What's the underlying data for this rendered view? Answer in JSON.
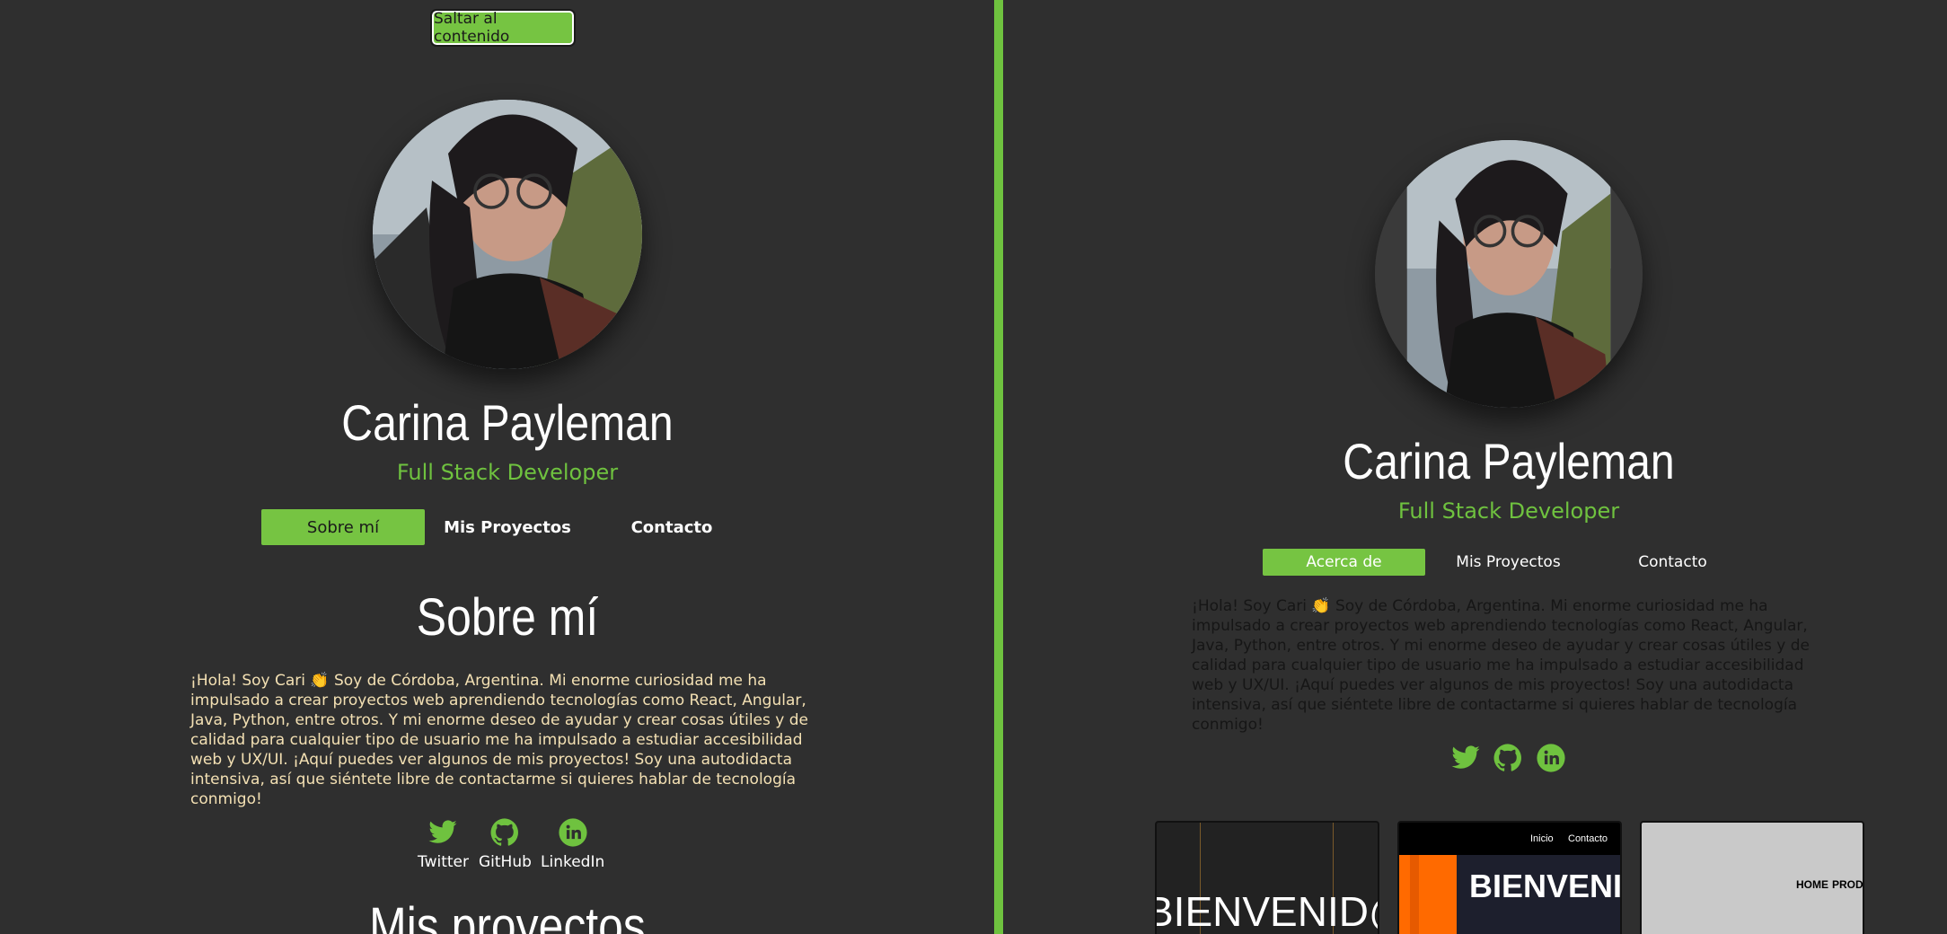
{
  "accent": "#6fc23f",
  "left": {
    "skip_link": "Saltar al contenido",
    "name": "Carina Payleman",
    "role": "Full Stack Developer",
    "nav": [
      "Sobre mí",
      "Mis Proyectos",
      "Contacto"
    ],
    "section_title": "Sobre mí",
    "bio": "¡Hola! Soy Cari 👏 Soy de Córdoba, Argentina. Mi enorme curiosidad me ha impulsado a crear proyectos web aprendiendo tecnologías como React, Angular, Java, Python, entre otros. Y mi enorme deseo de ayudar y crear cosas útiles y de calidad para cualquier tipo de usuario me ha impulsado a estudiar accesibilidad web y UX/UI. ¡Aquí puedes ver algunos de mis proyectos! Soy una autodidacta intensiva, así que siéntete libre de contactarme si quieres hablar de tecnología conmigo!",
    "social": [
      {
        "icon": "twitter-icon",
        "label": "Twitter"
      },
      {
        "icon": "github-icon",
        "label": "GitHub"
      },
      {
        "icon": "linkedin-icon",
        "label": "LinkedIn"
      }
    ],
    "next_section_title": "Mis proyectos"
  },
  "right": {
    "name": "Carina Payleman",
    "role": "Full Stack Developer",
    "nav": [
      "Acerca de",
      "Mis Proyectos",
      "Contacto"
    ],
    "bio": "¡Hola! Soy Cari 👏 Soy de Córdoba, Argentina. Mi enorme curiosidad me ha impulsado a crear proyectos web aprendiendo tecnologías como React, Angular, Java, Python, entre otros. Y mi enorme deseo de ayudar y crear cosas útiles y de calidad para cualquier tipo de usuario me ha impulsado a estudiar accesibilidad web y UX/UI. ¡Aquí puedes ver algunos de mis proyectos! Soy una autodidacta intensiva, así que siéntete libre de contactarme si quieres hablar de tecnología conmigo!",
    "social_icons": [
      "twitter-icon",
      "github-icon",
      "linkedin-icon"
    ],
    "projects": [
      {
        "headline": "BIENVENID@"
      },
      {
        "headline": "BIENVENID",
        "nav": [
          "Inicio",
          "Contacto"
        ]
      },
      {
        "nav": [
          "HOME",
          "PROD"
        ]
      }
    ]
  }
}
